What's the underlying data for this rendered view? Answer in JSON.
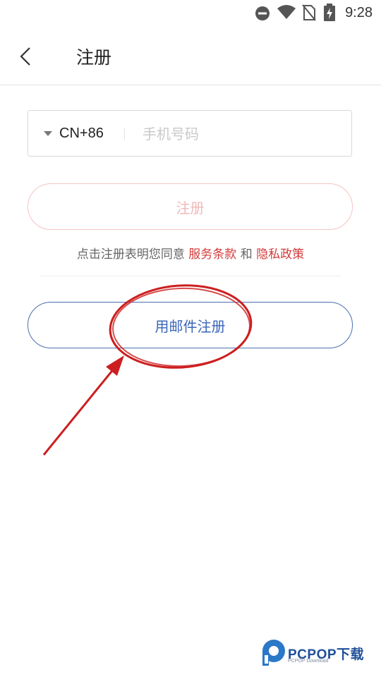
{
  "status_bar": {
    "time": "9:28",
    "icons": [
      "do-not-disturb-icon",
      "wifi-icon",
      "no-sim-icon",
      "battery-charging-icon"
    ]
  },
  "header": {
    "title": "注册",
    "back_icon": "chevron-left-icon"
  },
  "phone": {
    "country_code": "CN+86",
    "placeholder": "手机号码",
    "value": ""
  },
  "register_button": {
    "label": "注册"
  },
  "agreement": {
    "prefix": "点击注册表明您同意",
    "terms_link": "服务条款",
    "conjunction": "和",
    "privacy_link": "隐私政策"
  },
  "email_register_button": {
    "label": "用邮件注册"
  },
  "watermark": {
    "main": "PCPOP下载",
    "sub": "PCPOP Download"
  },
  "colors": {
    "accent_red": "#d43a3a",
    "disabled_red": "#f0b8b8",
    "email_blue": "#3a66b8",
    "annotation_red": "#cc1f1f"
  }
}
